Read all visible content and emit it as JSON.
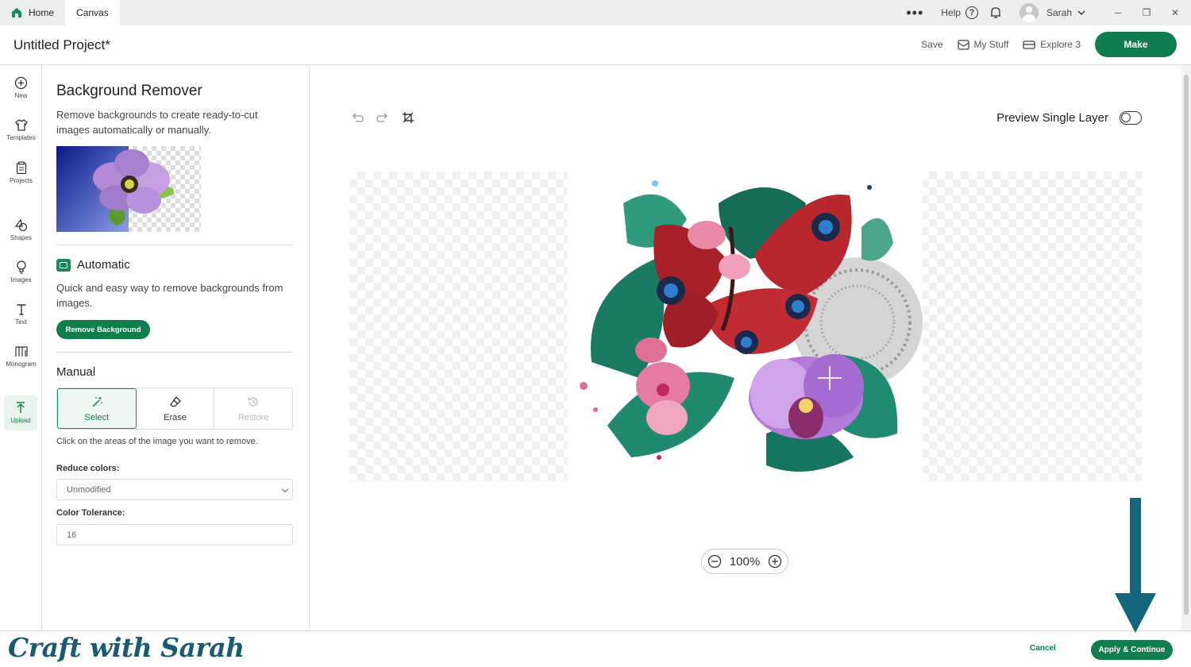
{
  "tabs": [
    {
      "label": "Home"
    },
    {
      "label": "Canvas"
    }
  ],
  "topbar": {
    "more": "•••",
    "help_label": "Help",
    "help_icon": "?",
    "user_name": "Sarah",
    "minimize": "─",
    "restore": "❐",
    "close": "✕"
  },
  "header": {
    "project_title": "Untitled Project*",
    "save_label": "Save",
    "my_stuff_label": "My Stuff",
    "machine_label": "Explore 3",
    "make_label": "Make"
  },
  "rail": [
    {
      "label": "New",
      "icon": "plus-circle-icon"
    },
    {
      "label": "Templates",
      "icon": "tshirt-icon"
    },
    {
      "label": "Projects",
      "icon": "clipboard-icon"
    },
    {
      "label": "Shapes",
      "icon": "shapes-icon"
    },
    {
      "label": "Images",
      "icon": "bulb-icon"
    },
    {
      "label": "Text",
      "icon": "text-icon"
    },
    {
      "label": "Monogram",
      "icon": "monogram-icon"
    },
    {
      "label": "Upload",
      "icon": "upload-icon"
    }
  ],
  "panel": {
    "title": "Background Remover",
    "description": "Remove backgrounds to create ready-to-cut images automatically or manually.",
    "automatic": {
      "title": "Automatic",
      "description": "Quick and easy way to remove backgrounds from images.",
      "button": "Remove Background"
    },
    "manual": {
      "title": "Manual",
      "tools": [
        {
          "label": "Select"
        },
        {
          "label": "Erase"
        },
        {
          "label": "Restore"
        }
      ],
      "hint": "Click on the areas of the image you want to remove.",
      "reduce_colors_label": "Reduce colors:",
      "reduce_colors_value": "Unmodified",
      "tolerance_label": "Color Tolerance:",
      "tolerance_value": "16"
    }
  },
  "canvas": {
    "preview_label": "Preview Single Layer",
    "preview_toggle_on": false,
    "zoom": "100%",
    "zoom_out": "−",
    "zoom_in": "+"
  },
  "footer": {
    "watermark": "Craft with Sarah",
    "cancel_label": "Cancel",
    "apply_label": "Apply & Continue"
  },
  "colors": {
    "brand_green": "#107d4f",
    "arrow_teal": "#14667d"
  }
}
